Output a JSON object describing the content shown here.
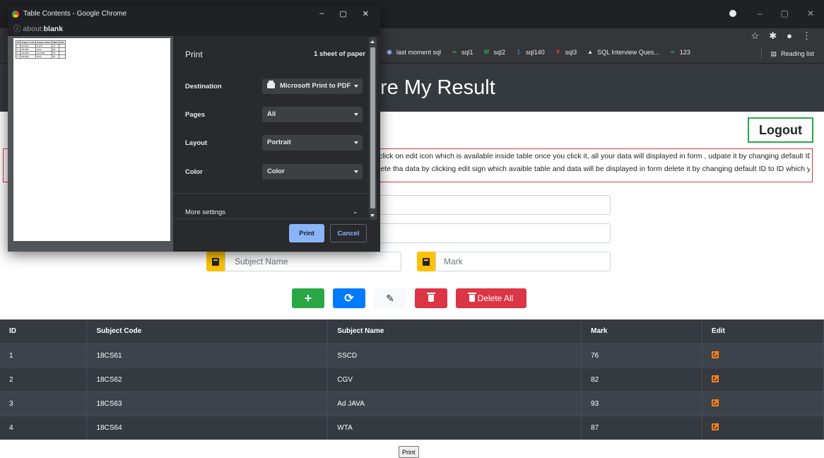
{
  "browser": {
    "window_controls": {
      "minimize": "–",
      "maximize": "▢",
      "close": "✕"
    },
    "bookmarks": [
      {
        "label": "last moment sql",
        "icon": "circle-icon",
        "color": "#8ab4f8"
      },
      {
        "label": "sql1",
        "icon": "dots-icon",
        "color": "#34a853"
      },
      {
        "label": "sql2",
        "icon": "w-icon",
        "color": "#34a853"
      },
      {
        "label": "sql140",
        "icon": "arc-icon",
        "color": "#4285f4"
      },
      {
        "label": "sql3",
        "icon": "v-icon",
        "color": "#ea4335"
      },
      {
        "label": "SQL Interview Ques...",
        "icon": "mountain-icon",
        "color": "#e8eaed"
      },
      {
        "label": "123",
        "icon": "dots-icon",
        "color": "#34a853"
      }
    ],
    "reading_list": "Reading list"
  },
  "page": {
    "title": "re My Result",
    "logout": "Logout",
    "notice_lines": [
      "click on edit icon which is available inside table once you click it, all your data will displayed in form , udpate it by changing default ID to ID",
      "lete tha data by clicking edit sign which avaible table and data will be displayed in form delete it by changing default ID to ID which you"
    ],
    "subject_name_placeholder": "Subject Name",
    "mark_placeholder": "Mark",
    "buttons": {
      "add": "+",
      "refresh": "⟳",
      "edit": "✎",
      "delete_all": "Delete All"
    },
    "table": {
      "headers": [
        "ID",
        "Subject Code",
        "Subject Name",
        "Mark",
        "Edit"
      ],
      "rows": [
        {
          "id": "1",
          "code": "18CS61",
          "name": "SSCD",
          "mark": "76"
        },
        {
          "id": "2",
          "code": "18CS62",
          "name": "CGV",
          "mark": "82"
        },
        {
          "id": "3",
          "code": "18CS63",
          "name": "Ad JAVA",
          "mark": "93"
        },
        {
          "id": "4",
          "code": "18CS64",
          "name": "WTA",
          "mark": "87"
        }
      ]
    },
    "print_button": "Print"
  },
  "popup": {
    "window_title": "Table Contents - Google Chrome",
    "url_prefix": "about:",
    "url_bold": "blank",
    "preview_table": {
      "headers": [
        "ID",
        "Subject Code",
        "Subject Name",
        "Mark",
        "Edit"
      ],
      "rows": [
        [
          "1",
          "18CS61",
          "SSCD",
          "76",
          ""
        ],
        [
          "2",
          "18CS62",
          "CGV",
          "82",
          ""
        ],
        [
          "3",
          "18CS63",
          "Ad JAVA",
          "93",
          ""
        ],
        [
          "4",
          "18CS64",
          "WTA",
          "87",
          ""
        ]
      ]
    },
    "print_panel": {
      "title": "Print",
      "sheets": "1 sheet of paper",
      "destination_label": "Destination",
      "destination_value": "Microsoft Print to PDF",
      "pages_label": "Pages",
      "pages_value": "All",
      "layout_label": "Layout",
      "layout_value": "Portrait",
      "color_label": "Color",
      "color_value": "Color",
      "more_settings": "More settings",
      "print": "Print",
      "cancel": "Cancel"
    }
  },
  "colors": {
    "header_dark": "#343a40",
    "logout_border": "#28a745",
    "notice_border": "#dc3545",
    "icon_bg": "#ffc107",
    "edit_icon": "#fd7e14",
    "print_primary": "#8ab4f8"
  }
}
